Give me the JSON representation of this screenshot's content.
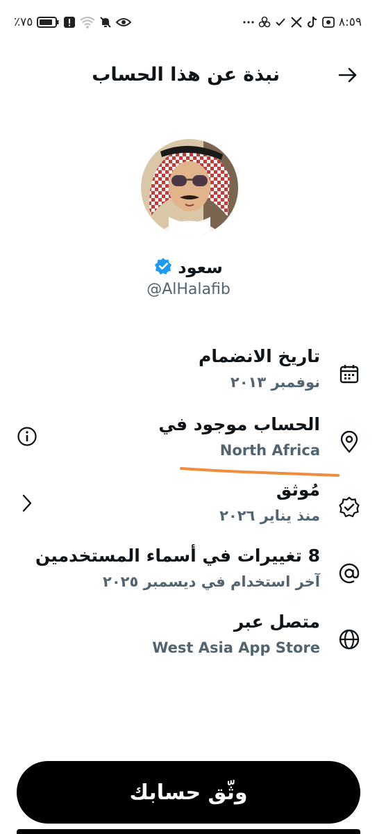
{
  "status_bar": {
    "time": "٨:٥٩",
    "battery": "٪٧٥"
  },
  "header": {
    "title": "نبذة عن هذا الحساب"
  },
  "profile": {
    "display_name": "سعود",
    "handle": "@AlHalafib"
  },
  "info": [
    {
      "title": "تاريخ الانضمام",
      "subtitle": "نوفمبر ٢٠١٣",
      "icon": "calendar-icon"
    },
    {
      "title": "الحساب موجود في",
      "subtitle": "North Africa",
      "icon": "location-pin-icon"
    },
    {
      "title": "مُوثق",
      "subtitle": "منذ يناير ٢٠٢٦",
      "icon": "verified-badge-icon"
    },
    {
      "title": "8 تغييرات في أسماء المستخدمين",
      "subtitle": "آخر استخدام في ديسمبر ٢٠٢٥",
      "icon": "at-sign-icon"
    },
    {
      "title": "متصل عبر",
      "subtitle": "West Asia App Store",
      "icon": "globe-icon"
    }
  ],
  "actions": {
    "verify_label": "وثّق حسابك"
  },
  "colors": {
    "verified_blue": "#1d9bf0",
    "secondary_text": "#536471",
    "annotation_orange": "#f08c3c"
  }
}
